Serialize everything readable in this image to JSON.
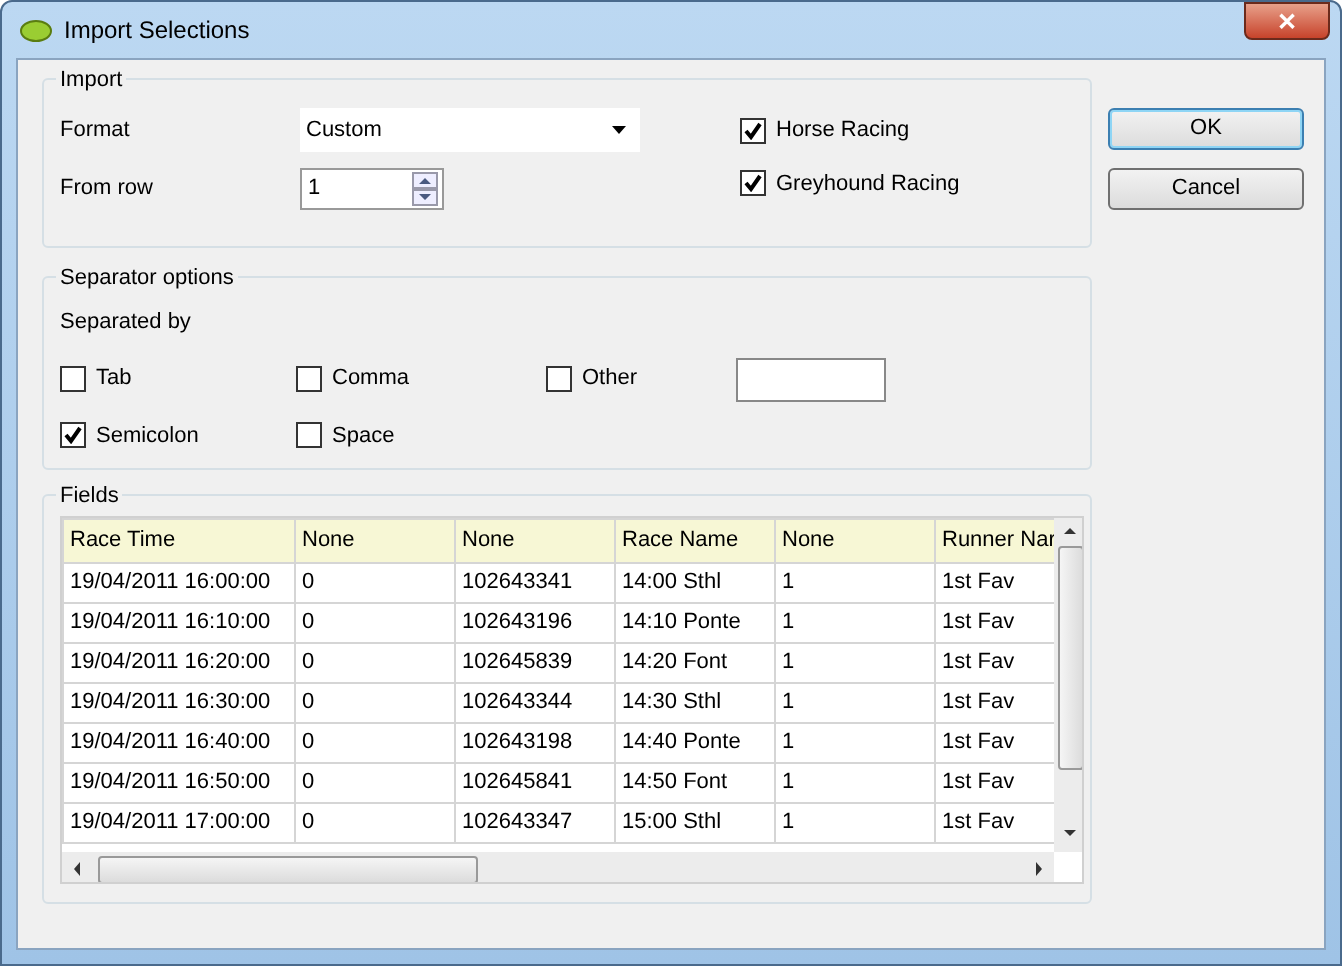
{
  "window": {
    "title": "Import Selections",
    "close": "✕"
  },
  "import": {
    "legend": "Import",
    "format_label": "Format",
    "format_value": "Custom",
    "from_row_label": "From row",
    "from_row_value": "1",
    "checks": [
      {
        "label": "Horse Racing",
        "checked": true
      },
      {
        "label": "Greyhound Racing",
        "checked": true
      }
    ]
  },
  "buttons": [
    {
      "label": "OK",
      "default": true
    },
    {
      "label": "Cancel",
      "default": false
    }
  ],
  "separator": {
    "legend": "Separator options",
    "caption": "Separated by",
    "options": [
      {
        "label": "Tab",
        "checked": false
      },
      {
        "label": "Comma",
        "checked": false
      },
      {
        "label": "Other",
        "checked": false
      },
      {
        "label": "Semicolon",
        "checked": true
      },
      {
        "label": "Space",
        "checked": false
      }
    ]
  },
  "fields": {
    "legend": "Fields",
    "columns": [
      "Race Time",
      "None",
      "None",
      "Race Name",
      "None",
      "Runner Nar"
    ],
    "rows": [
      [
        "19/04/2011 16:00:00",
        "0",
        "102643341",
        "14:00 Sthl",
        "1",
        "1st Fav"
      ],
      [
        "19/04/2011 16:10:00",
        "0",
        "102643196",
        "14:10 Ponte",
        "1",
        "1st Fav"
      ],
      [
        "19/04/2011 16:20:00",
        "0",
        "102645839",
        "14:20 Font",
        "1",
        "1st Fav"
      ],
      [
        "19/04/2011 16:30:00",
        "0",
        "102643344",
        "14:30 Sthl",
        "1",
        "1st Fav"
      ],
      [
        "19/04/2011 16:40:00",
        "0",
        "102643198",
        "14:40 Ponte",
        "1",
        "1st Fav"
      ],
      [
        "19/04/2011 16:50:00",
        "0",
        "102645841",
        "14:50 Font",
        "1",
        "1st Fav"
      ],
      [
        "19/04/2011 17:00:00",
        "0",
        "102643347",
        "15:00 Sthl",
        "1",
        "1st Fav"
      ]
    ]
  }
}
